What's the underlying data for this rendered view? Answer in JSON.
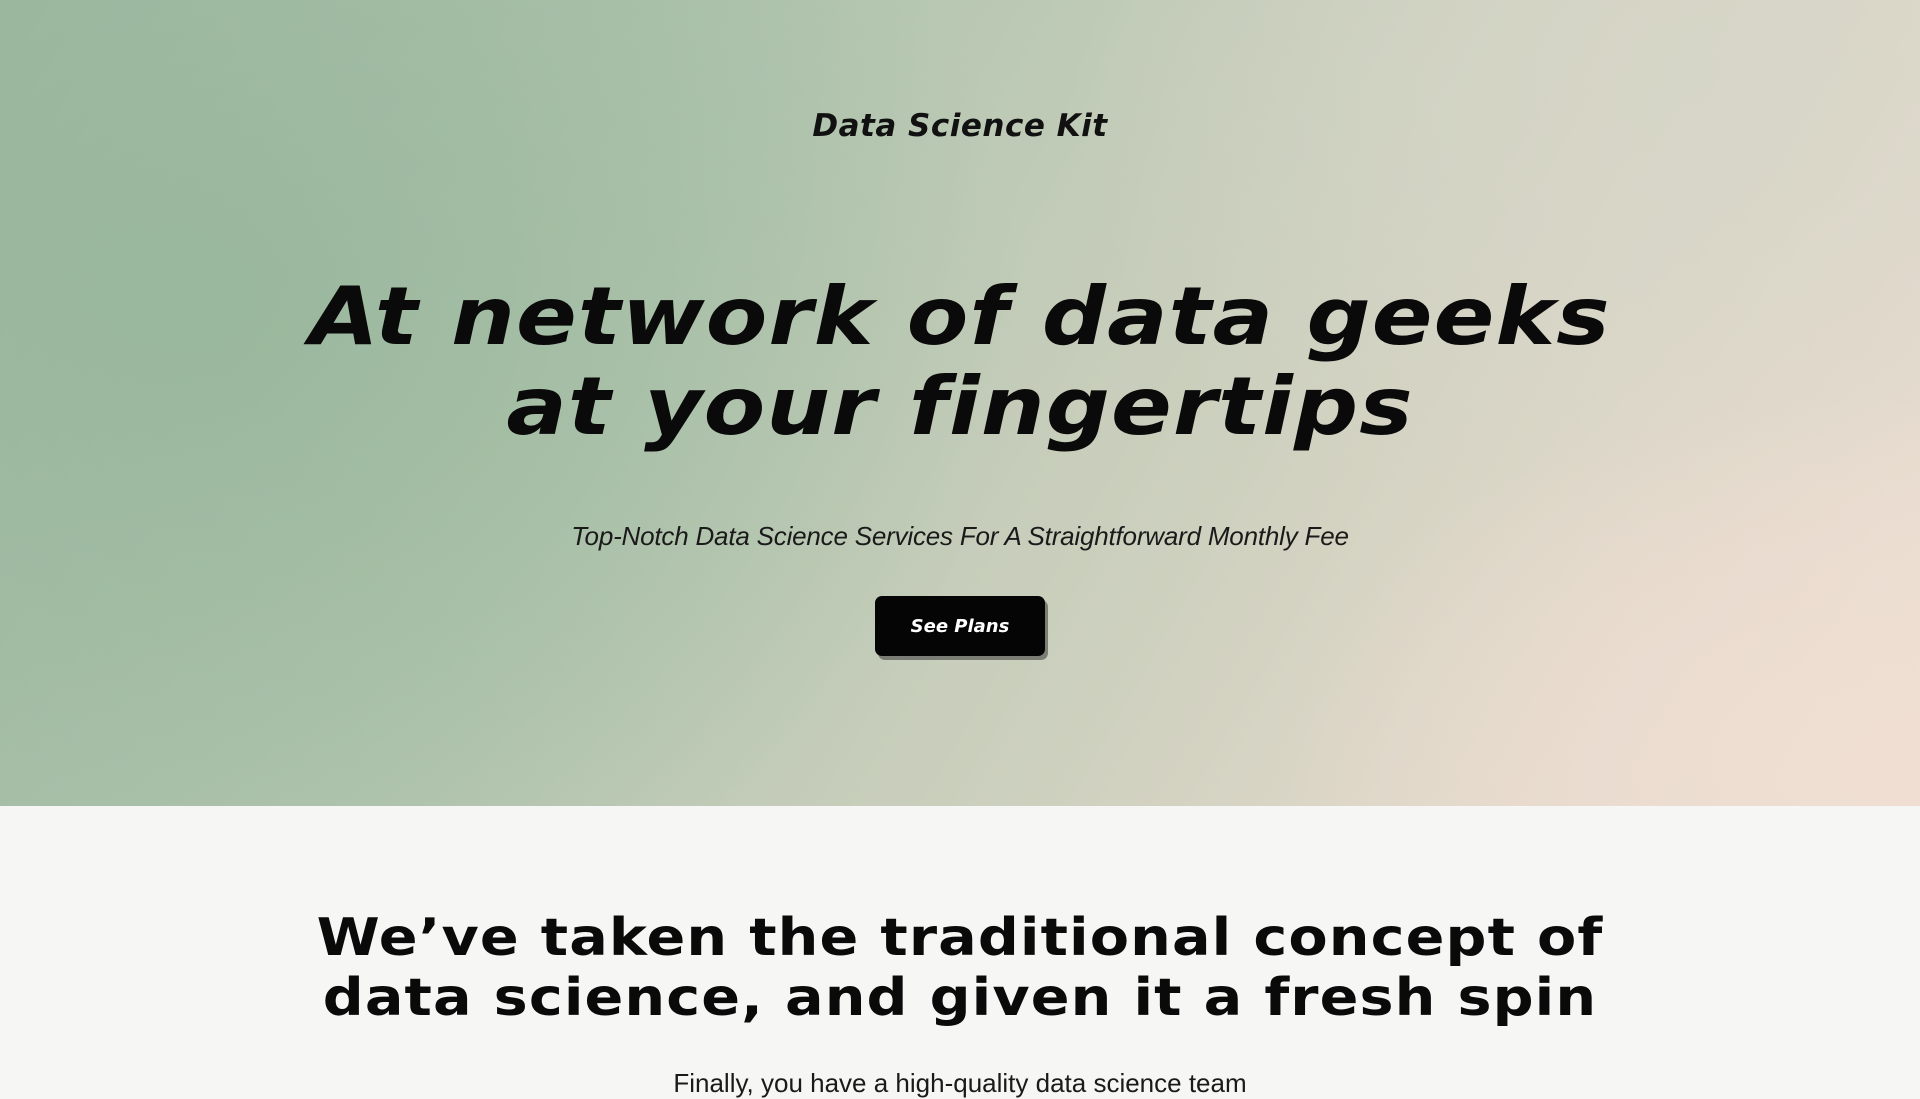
{
  "hero": {
    "brand": "Data Science Kit",
    "headline_line1": "At network of data geeks",
    "headline_line2": "at your fingertips",
    "subtitle": "Top-Notch Data Science Services For A Straightforward Monthly Fee",
    "cta_label": "See Plans"
  },
  "section2": {
    "title_line1": "We’ve taken the traditional concept of",
    "title_line2": "data science, and given it a fresh spin",
    "body": "Finally, you have a high-quality data science team"
  },
  "colors": {
    "hero_gradient_start": "#9db8a0",
    "hero_gradient_end": "#eedfd4",
    "cta_background": "#050505",
    "cta_text": "#ffffff",
    "section_background": "#f6f6f5"
  }
}
